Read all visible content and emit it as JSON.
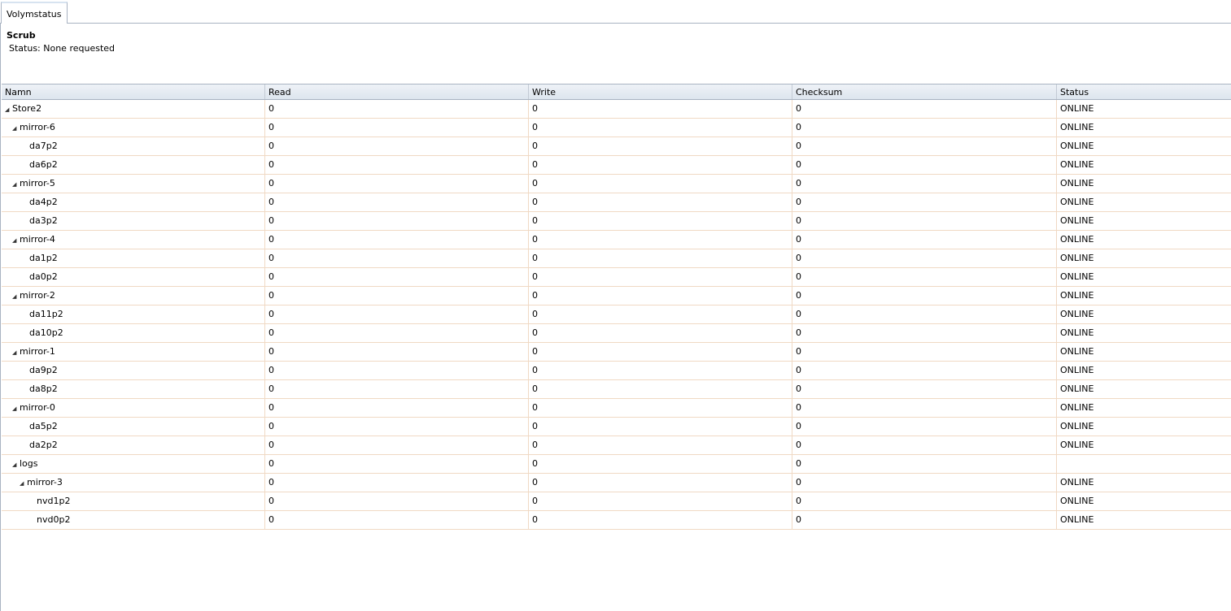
{
  "tab": {
    "label": "Volymstatus"
  },
  "scrub": {
    "title": "Scrub",
    "status": "Status: None requested"
  },
  "table": {
    "columns": [
      "Namn",
      "Read",
      "Write",
      "Checksum",
      "Status"
    ],
    "rows": [
      {
        "level": 0,
        "expanded": true,
        "name": "Store2",
        "read": "0",
        "write": "0",
        "checksum": "0",
        "status": "ONLINE"
      },
      {
        "level": 1,
        "expanded": true,
        "name": "mirror-6",
        "read": "0",
        "write": "0",
        "checksum": "0",
        "status": "ONLINE"
      },
      {
        "level": 2,
        "expanded": null,
        "name": "da7p2",
        "read": "0",
        "write": "0",
        "checksum": "0",
        "status": "ONLINE"
      },
      {
        "level": 2,
        "expanded": null,
        "name": "da6p2",
        "read": "0",
        "write": "0",
        "checksum": "0",
        "status": "ONLINE"
      },
      {
        "level": 1,
        "expanded": true,
        "name": "mirror-5",
        "read": "0",
        "write": "0",
        "checksum": "0",
        "status": "ONLINE"
      },
      {
        "level": 2,
        "expanded": null,
        "name": "da4p2",
        "read": "0",
        "write": "0",
        "checksum": "0",
        "status": "ONLINE"
      },
      {
        "level": 2,
        "expanded": null,
        "name": "da3p2",
        "read": "0",
        "write": "0",
        "checksum": "0",
        "status": "ONLINE"
      },
      {
        "level": 1,
        "expanded": true,
        "name": "mirror-4",
        "read": "0",
        "write": "0",
        "checksum": "0",
        "status": "ONLINE"
      },
      {
        "level": 2,
        "expanded": null,
        "name": "da1p2",
        "read": "0",
        "write": "0",
        "checksum": "0",
        "status": "ONLINE"
      },
      {
        "level": 2,
        "expanded": null,
        "name": "da0p2",
        "read": "0",
        "write": "0",
        "checksum": "0",
        "status": "ONLINE"
      },
      {
        "level": 1,
        "expanded": true,
        "name": "mirror-2",
        "read": "0",
        "write": "0",
        "checksum": "0",
        "status": "ONLINE"
      },
      {
        "level": 2,
        "expanded": null,
        "name": "da11p2",
        "read": "0",
        "write": "0",
        "checksum": "0",
        "status": "ONLINE"
      },
      {
        "level": 2,
        "expanded": null,
        "name": "da10p2",
        "read": "0",
        "write": "0",
        "checksum": "0",
        "status": "ONLINE"
      },
      {
        "level": 1,
        "expanded": true,
        "name": "mirror-1",
        "read": "0",
        "write": "0",
        "checksum": "0",
        "status": "ONLINE"
      },
      {
        "level": 2,
        "expanded": null,
        "name": "da9p2",
        "read": "0",
        "write": "0",
        "checksum": "0",
        "status": "ONLINE"
      },
      {
        "level": 2,
        "expanded": null,
        "name": "da8p2",
        "read": "0",
        "write": "0",
        "checksum": "0",
        "status": "ONLINE"
      },
      {
        "level": 1,
        "expanded": true,
        "name": "mirror-0",
        "read": "0",
        "write": "0",
        "checksum": "0",
        "status": "ONLINE"
      },
      {
        "level": 2,
        "expanded": null,
        "name": "da5p2",
        "read": "0",
        "write": "0",
        "checksum": "0",
        "status": "ONLINE"
      },
      {
        "level": 2,
        "expanded": null,
        "name": "da2p2",
        "read": "0",
        "write": "0",
        "checksum": "0",
        "status": "ONLINE"
      },
      {
        "level": 1,
        "expanded": true,
        "name": "logs",
        "read": "0",
        "write": "0",
        "checksum": "0",
        "status": ""
      },
      {
        "level": 2,
        "expanded": true,
        "name": "mirror-3",
        "read": "0",
        "write": "0",
        "checksum": "0",
        "status": "ONLINE"
      },
      {
        "level": 3,
        "expanded": null,
        "name": "nvd1p2",
        "read": "0",
        "write": "0",
        "checksum": "0",
        "status": "ONLINE"
      },
      {
        "level": 3,
        "expanded": null,
        "name": "nvd0p2",
        "read": "0",
        "write": "0",
        "checksum": "0",
        "status": "ONLINE"
      }
    ]
  }
}
